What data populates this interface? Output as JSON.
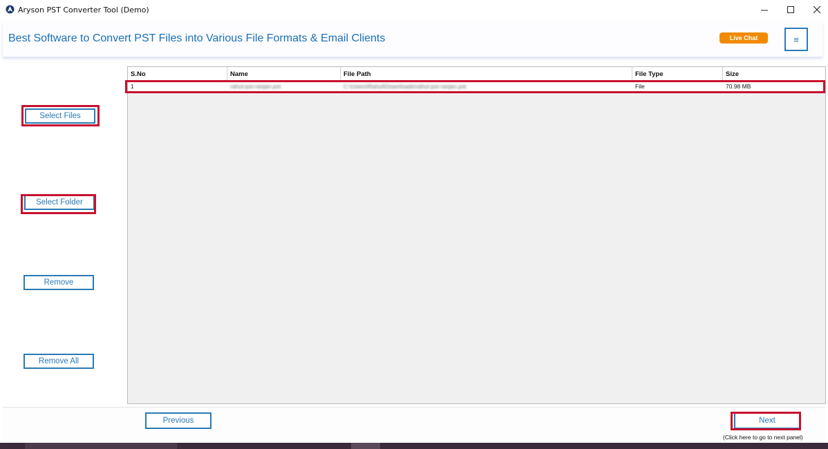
{
  "window": {
    "title": "Aryson PST Converter Tool (Demo)",
    "controls": {
      "minimize": "—",
      "maximize": "☐",
      "close": "✕"
    }
  },
  "header": {
    "title": "Best Software to Convert PST Files into Various File Formats & Email Clients",
    "live_chat": "Live Chat",
    "menu_icon": "≡"
  },
  "sidebar": {
    "select_files": "Select Files",
    "select_folder": "Select Folder",
    "remove": "Remove",
    "remove_all": "Remove All"
  },
  "table": {
    "columns": [
      "S.No",
      "Name",
      "File Path",
      "File Type",
      "Size"
    ],
    "rows": [
      {
        "sno": "1",
        "name": "rahul-pst-ranjan.pst",
        "path": "C:\\Users\\Rahul\\Downloads\\rahul-pst-ranjan.pst",
        "type": "File",
        "size": "70.98 MB"
      }
    ]
  },
  "footer": {
    "previous": "Previous",
    "next": "Next",
    "next_hint": "(Click here to go to next panel)"
  },
  "colors": {
    "accent": "#2a7ab5",
    "highlight": "#c8102e",
    "live_chat": "#f28a00"
  }
}
